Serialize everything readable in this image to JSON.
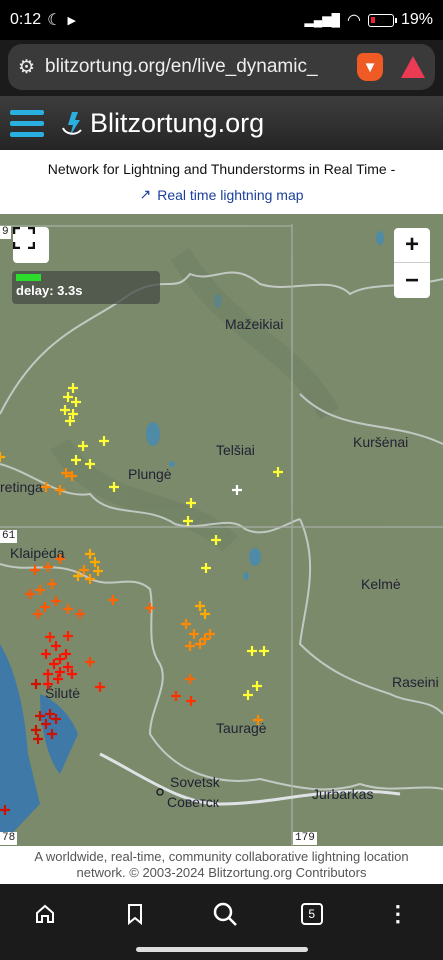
{
  "status": {
    "time": "0:12",
    "battery": "19%",
    "battery_level": 0.19
  },
  "browser": {
    "url": "blitzortung.org/en/live_dynamic_",
    "tab_count": "5"
  },
  "site": {
    "name": "Blitzortung.org",
    "subtitle": "Network for Lightning and Thunderstorms in Real Time -",
    "map_link": "Real time lightning map"
  },
  "map": {
    "delay": "delay: 3.3s",
    "places": [
      "Mažeikiai",
      "Telšiai",
      "Kuršėnai",
      "retinga",
      "Plungė",
      "Klaipėda",
      "Kelmė",
      "Šilutė",
      "Raseini",
      "Tauragė",
      "Sovetsk",
      "Советск",
      "Jurbarkas"
    ],
    "grid_labels": [
      "9",
      "61",
      "78",
      "179"
    ]
  },
  "footer": {
    "line1": "A worldwide, real-time, community collaborative lightning location",
    "line2": "network. © 2003-2024 Blitzortung.org Contributors"
  },
  "colors": {
    "accent": "#2ab0e0",
    "link": "#1a3f9c",
    "map_bg": "#7b8a6b"
  }
}
